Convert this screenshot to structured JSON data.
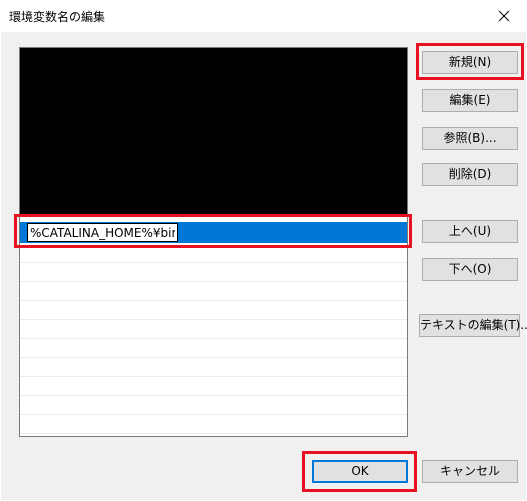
{
  "window": {
    "title": "環境変数名の編集"
  },
  "list": {
    "edit_value": "%CATALINA_HOME%¥bin"
  },
  "buttons": {
    "new": "新規(N)",
    "edit": "編集(E)",
    "browse": "参照(B)...",
    "delete": "削除(D)",
    "up": "上へ(U)",
    "down": "下へ(O)",
    "edit_text": "テキストの編集(T)...",
    "ok": "OK",
    "cancel": "キャンセル"
  },
  "colors": {
    "highlight": "#e81123",
    "selection": "#0078d7"
  },
  "icons": {
    "close": "close-icon"
  }
}
